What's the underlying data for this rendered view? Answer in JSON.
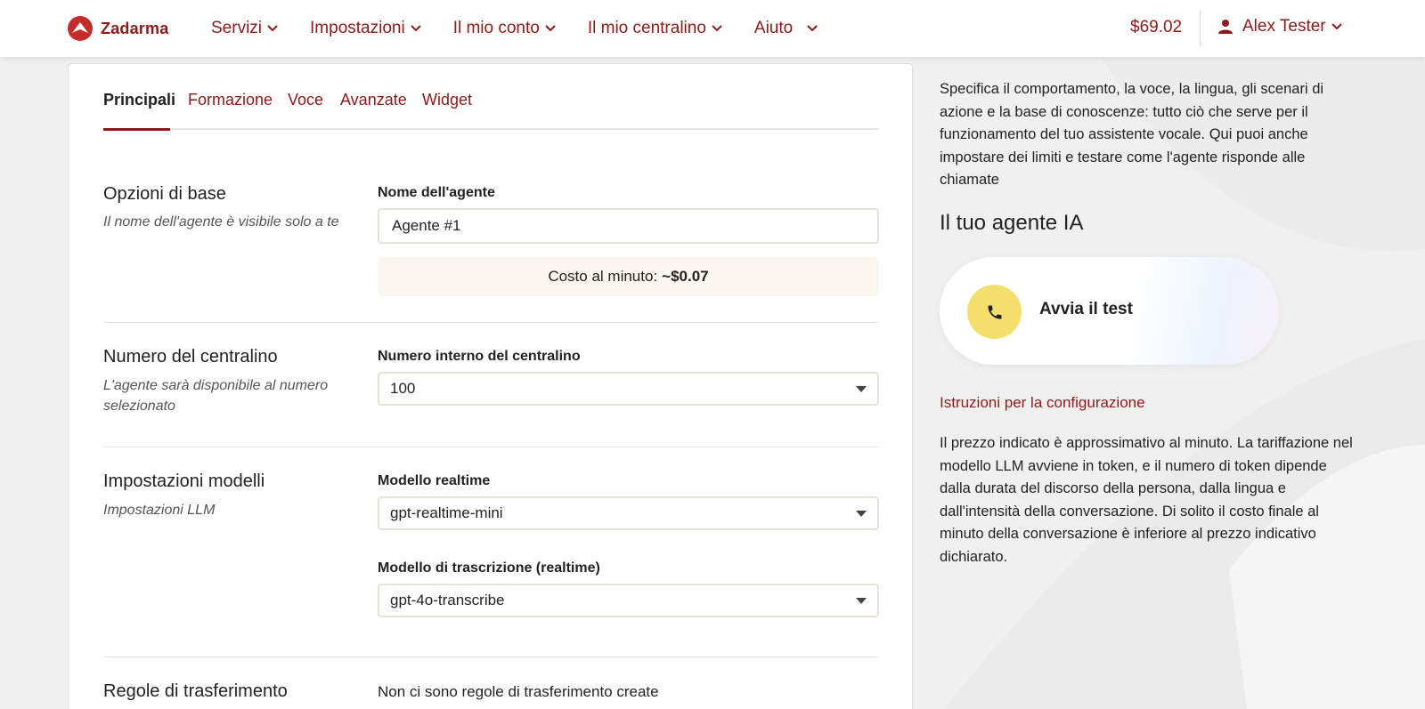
{
  "header": {
    "logo_text": "Zadarma",
    "nav": [
      {
        "label": "Servizi"
      },
      {
        "label": "Impostazioni"
      },
      {
        "label": "Il mio conto"
      },
      {
        "label": "Il mio centralino"
      },
      {
        "label": "Aiuto"
      }
    ],
    "balance": "$69.02",
    "user_name": "Alex Tester"
  },
  "tabs": [
    {
      "label": "Principali",
      "active": true
    },
    {
      "label": "Formazione"
    },
    {
      "label": "Voce"
    },
    {
      "label": "Avanzate"
    },
    {
      "label": "Widget"
    }
  ],
  "sections": {
    "basic": {
      "title": "Opzioni di base",
      "desc": "Il nome dell'agente è visibile solo a te",
      "field_label": "Nome dell'agente",
      "field_value": "Agente #1",
      "cost_label": "Costo al minuto:",
      "cost_value": "~$0.07"
    },
    "pbx": {
      "title": "Numero del centralino",
      "desc": "L'agente sarà disponibile al numero selezionato",
      "field_label": "Numero interno del centralino",
      "field_value": "100"
    },
    "models": {
      "title": "Impostazioni modelli",
      "desc": "Impostazioni LLM",
      "realtime_label": "Modello realtime",
      "realtime_value": "gpt-realtime-mini",
      "transcribe_label": "Modello di trascrizione (realtime)",
      "transcribe_value": "gpt-4o-transcribe"
    },
    "transfer": {
      "title": "Regole di trasferimento",
      "text": "Non ci sono regole di trasferimento create"
    }
  },
  "right": {
    "intro": "Specifica il comportamento, la voce, la lingua, gli scenari di azione e la base di conoscenze: tutto ciò che serve per il funzionamento del tuo assistente vocale. Qui puoi anche impostare dei limiti e testare come l'agente risponde alle chiamate",
    "agent_title": "Il tuo agente IA",
    "test_button": "Avvia il test",
    "instructions_link": "Istruzioni per la configurazione",
    "pricing_note": "Il prezzo indicato è approssimativo al minuto. La tariffazione nel modello LLM avviene in token, e il numero di token dipende dalla durata del discorso della persona, dalla lingua e dall'intensità della conversazione. Di solito il costo finale al minuto della conversazione è inferiore al prezzo indicativo dichiarato."
  },
  "colors": {
    "brand": "#8b1a1a",
    "call_button": "#f5df6c",
    "cost_bg": "#fbf6ef"
  }
}
